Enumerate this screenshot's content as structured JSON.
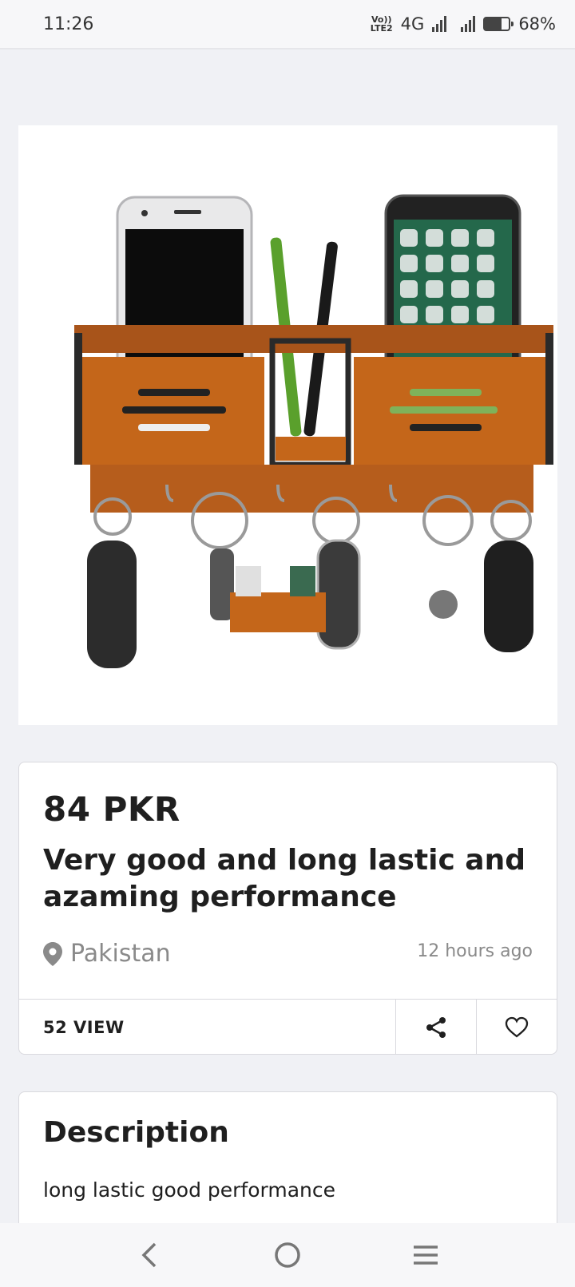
{
  "status_bar": {
    "time": "11:26",
    "network_tag_top": "Vo))",
    "network_tag_bottom": "LTE2",
    "network_type": "4G",
    "battery_percent": 68,
    "battery_label": "68%"
  },
  "product": {
    "price": "84 PKR",
    "title": "Very good and long lastic and azaming performance",
    "location": "Pakistan",
    "posted": "12 hours ago",
    "views": "52 VIEW"
  },
  "description": {
    "heading": "Description",
    "text": "long lastic good performance"
  },
  "icons": {
    "location": "map-pin-icon",
    "share": "share-icon",
    "favorite": "heart-icon",
    "back": "back-icon",
    "home": "home-icon",
    "menu": "menu-icon"
  },
  "colors": {
    "background": "#f0f1f5",
    "text": "#1f1f1f",
    "muted": "#8a8a8a",
    "wood": "#c4661a"
  }
}
